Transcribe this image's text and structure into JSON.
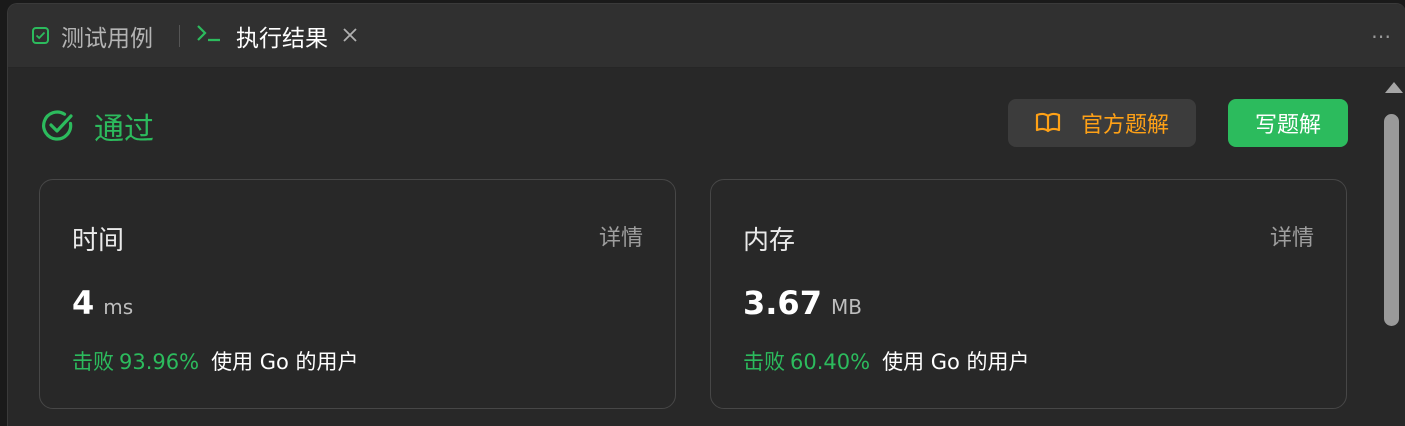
{
  "tabs": [
    {
      "label": "测试用例",
      "icon": "checkbox-icon"
    },
    {
      "label": "执行结果",
      "icon": "terminal-icon",
      "closable": true
    }
  ],
  "toolbar": {
    "more_icon": "more-icon"
  },
  "status": {
    "text": "通过",
    "icon": "check-circle-icon",
    "color": "#2cbb5d"
  },
  "buttons": {
    "official_solution": {
      "label": "官方题解",
      "icon": "book-icon",
      "color": "#ffa116"
    },
    "write_solution": {
      "label": "写题解",
      "color": "#2cbb5d"
    }
  },
  "cards": {
    "time": {
      "title": "时间",
      "detail": "详情",
      "value": "4",
      "unit": "ms",
      "beat_label": "击败",
      "beat_percent": "93.96%",
      "beat_desc": "使用 Go 的用户"
    },
    "memory": {
      "title": "内存",
      "detail": "详情",
      "value": "3.67",
      "unit": "MB",
      "beat_label": "击败",
      "beat_percent": "60.40%",
      "beat_desc": "使用 Go 的用户"
    }
  }
}
